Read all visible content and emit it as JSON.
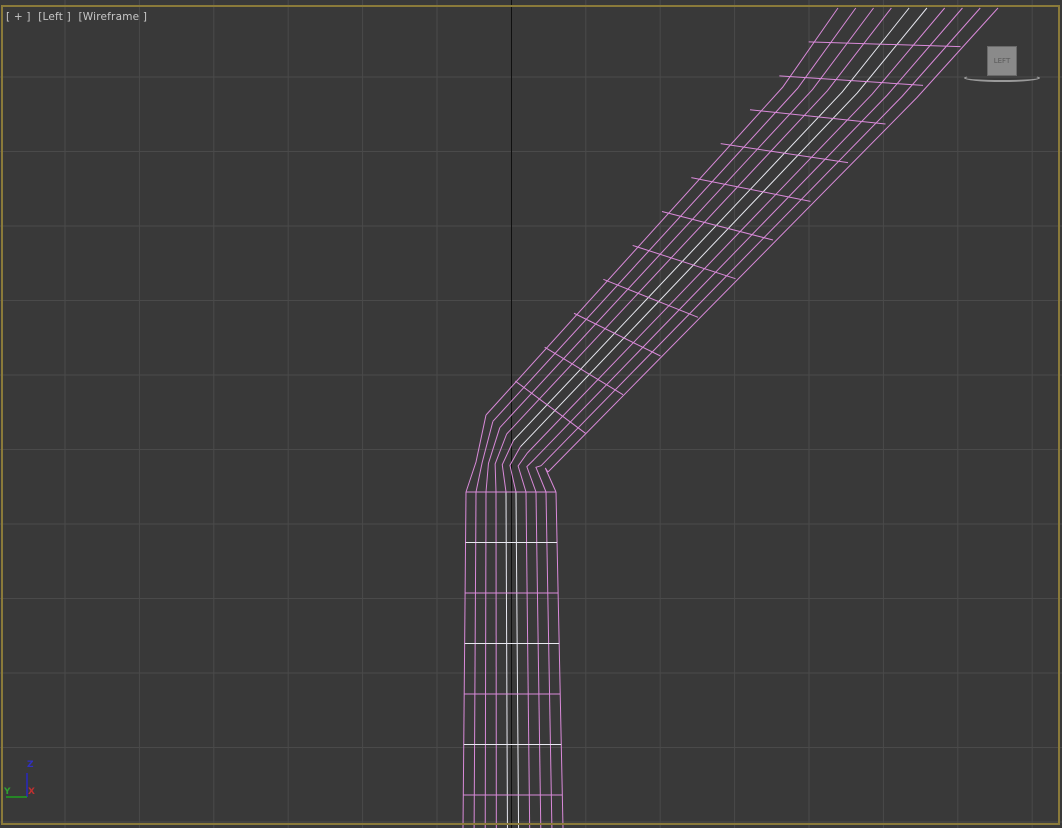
{
  "viewport": {
    "label_plus": "[ + ]",
    "label_view": "[Left ]",
    "label_mode": "[Wireframe ]",
    "viewcube_face": "LEFT",
    "axis_labels": {
      "z": "Z",
      "x": "X",
      "y": "Y"
    },
    "colors": {
      "background": "#393939",
      "grid": "#4a4a4a",
      "frame": "#8a7a3a",
      "wire": "#d98ad9",
      "wire_selected": "#e8e8f0"
    }
  }
}
